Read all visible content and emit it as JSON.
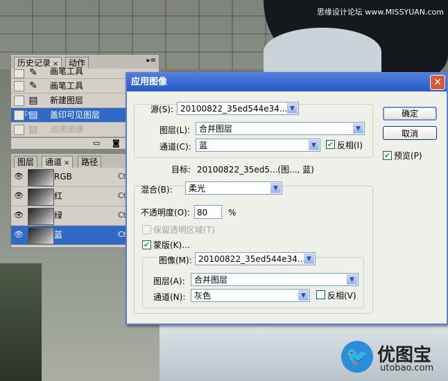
{
  "watermark": "思缘设计论坛 www.MISSYUAN.com",
  "logo": {
    "title": "优图宝",
    "sub": "utobao.com"
  },
  "history_panel": {
    "tabs": [
      {
        "label": "历史记录"
      },
      {
        "label": "动作"
      }
    ],
    "items": [
      {
        "label": "画笔工具",
        "icon": "brush-icon"
      },
      {
        "label": "画笔工具",
        "icon": "brush-icon"
      },
      {
        "label": "新建图层",
        "icon": "document-icon"
      },
      {
        "label": "盖印可见图层",
        "icon": "document-icon",
        "selected": true
      },
      {
        "label": "应用图像",
        "icon": "document-icon",
        "disabled": true
      }
    ]
  },
  "channels_panel": {
    "tabs": [
      {
        "label": "图层"
      },
      {
        "label": "通道"
      },
      {
        "label": "路径"
      }
    ],
    "items": [
      {
        "label": "RGB",
        "shortcut": "Ct"
      },
      {
        "label": "红",
        "shortcut": "Ct"
      },
      {
        "label": "绿",
        "shortcut": "Ct"
      },
      {
        "label": "蓝",
        "shortcut": "Ct",
        "selected": true
      }
    ]
  },
  "dialog": {
    "title": "应用图像",
    "source_label": "源(S):",
    "source_value": "20100822_35ed544e34...",
    "layer_label": "图层(L):",
    "layer_value": "合并图层",
    "channel_label": "通道(C):",
    "channel_value": "蓝",
    "invert_label": "反相(I)",
    "target_label": "目标:",
    "target_value": "20100822_35ed5...(图..., 蓝)",
    "blending_label": "混合(B):",
    "blending_value": "柔光",
    "opacity_label": "不透明度(O):",
    "opacity_value": "80",
    "opacity_unit": "%",
    "preserve_label": "保留透明区域(T)",
    "mask_label": "蒙版(K)...",
    "mask_image_label": "图像(M):",
    "mask_image_value": "20100822_35ed544e34...",
    "mask_layer_label": "图层(A):",
    "mask_layer_value": "合并图层",
    "mask_channel_label": "通道(N):",
    "mask_channel_value": "灰色",
    "mask_invert_label": "反相(V)",
    "ok_label": "确定",
    "cancel_label": "取消",
    "preview_label": "预览(P)",
    "invert_checked": true,
    "mask_checked": true,
    "preview_checked": true,
    "mask_invert_checked": false
  }
}
